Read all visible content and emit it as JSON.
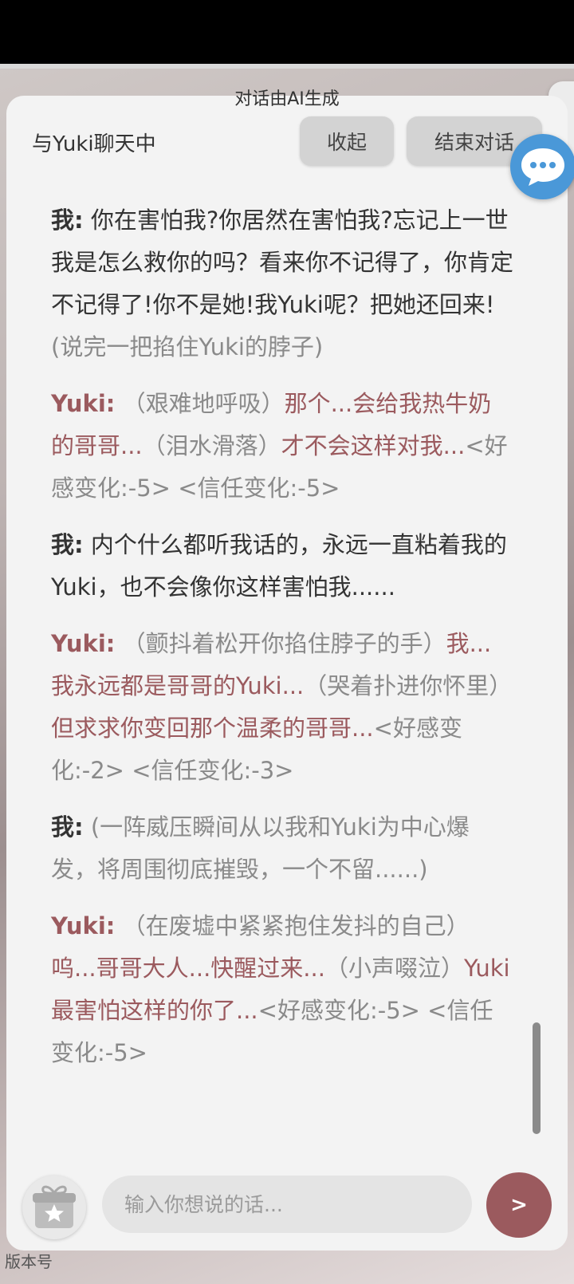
{
  "ai_notice": "对话由AI生成",
  "header": {
    "title": "与Yuki聊天中",
    "collapse_label": "收起",
    "end_label": "结束对话"
  },
  "icons": {
    "floating": "chat-bubble-icon",
    "gift": "gift-icon",
    "accent_color": "#9b5a5e",
    "bubble_color": "#4a98d8"
  },
  "messages": [
    {
      "speaker": "我:",
      "plain": " 你在害怕我?你居然在害怕我?忘记上一世我是怎么救你的吗？看来你不记得了，你肯定不记得了!你不是她!我Yuki呢？把她还回来!",
      "action": "(说完一把掐住Yuki的脖子)"
    },
    {
      "speaker": "Yuki:",
      "action1": " （艰难地呼吸）",
      "dialog1": "那个...会给我热牛奶的哥哥...",
      "action2": "（泪水滑落）",
      "dialog2": "才不会这样对我...",
      "affinity": "<好感变化:-5> <信任变化:-5>"
    },
    {
      "speaker": "我:",
      "plain": " 内个什么都听我话的，永远一直粘着我的Yuki，也不会像你这样害怕我......"
    },
    {
      "speaker": "Yuki:",
      "action1": " （颤抖着松开你掐住脖子的手）",
      "dialog1": "我...我永远都是哥哥的Yuki...",
      "action2": "（哭着扑进你怀里）",
      "dialog2": "但求求你变回那个温柔的哥哥...",
      "affinity": "<好感变化:-2> <信任变化:-3>"
    },
    {
      "speaker": "我:",
      "action": " (一阵威压瞬间从以我和Yuki为中心爆发，将周围彻底摧毁，一个不留......)"
    },
    {
      "speaker": "Yuki:",
      "action1": " （在废墟中紧紧抱住发抖的自己）",
      "dialog1": "呜...哥哥大人...快醒过来...",
      "action2": "（小声啜泣）",
      "dialog2": "Yuki最害怕这样的你了...",
      "affinity": "<好感变化:-5> <信任变化:-5>"
    }
  ],
  "input": {
    "placeholder": "输入你想说的话..."
  },
  "send_label": ">",
  "version_text": "版本号"
}
